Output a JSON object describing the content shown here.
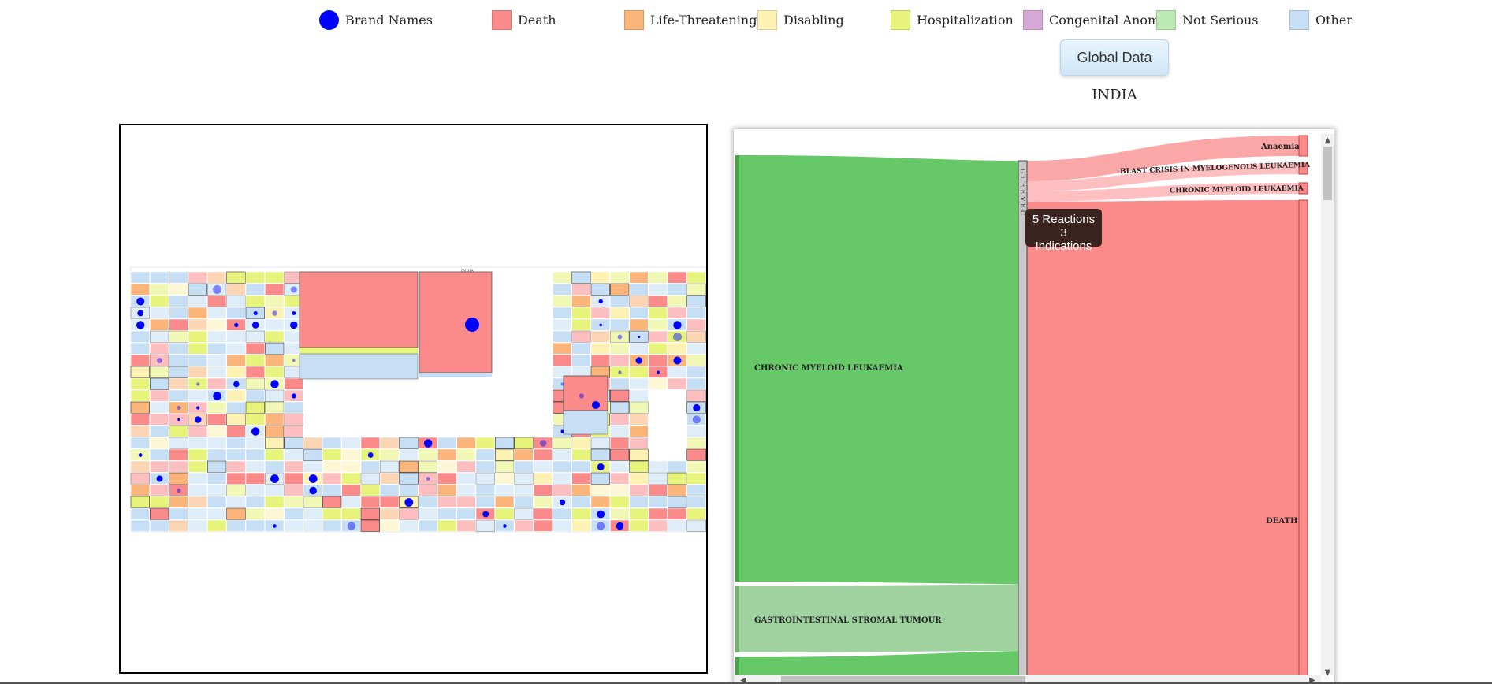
{
  "legend": [
    {
      "label": "Brand Names",
      "color": "#0000ff",
      "shape": "circle"
    },
    {
      "label": "Death",
      "color": "#fb8a8a",
      "shape": "square"
    },
    {
      "label": "Life-Threatening",
      "color": "#fbb47a",
      "shape": "square"
    },
    {
      "label": "Disabling",
      "color": "#fdf1b4",
      "shape": "square"
    },
    {
      "label": "Hospitalization",
      "color": "#e6f47c",
      "shape": "square"
    },
    {
      "label": "Congenital Anomali",
      "color": "#d6a8d6",
      "shape": "square"
    },
    {
      "label": "Not Serious",
      "color": "#bde9b4",
      "shape": "square"
    },
    {
      "label": "Other",
      "color": "#c6dff5",
      "shape": "square"
    }
  ],
  "global_button": "Global Data",
  "country": "INDIA",
  "treemap": {
    "title": "INDIA"
  },
  "sankey": {
    "left_nodes": [
      "CHRONIC MYELOID LEUKAEMIA",
      "GASTROINTESTINAL STROMAL TUMOUR"
    ],
    "middle_node": "GLEEVEC",
    "right_nodes": [
      "Anaemia",
      "BLAST CRISIS IN MYELOGENOUS LEUKAEMIA",
      "CHRONIC MYELOID LEUKAEMIA",
      "DEATH"
    ]
  },
  "tooltip": {
    "line1": "5 Reactions",
    "line2": "3 Indications"
  },
  "colors": {
    "death": "#fb8a8a",
    "life": "#fbb47a",
    "disabling": "#fdf1b4",
    "hosp": "#e6f47c",
    "congenital": "#d6a8d6",
    "notserious": "#bde9b4",
    "other": "#c6dff5",
    "indication": "#67c868",
    "indication_light": "#a0d2a0",
    "brand": "#0000ff"
  }
}
